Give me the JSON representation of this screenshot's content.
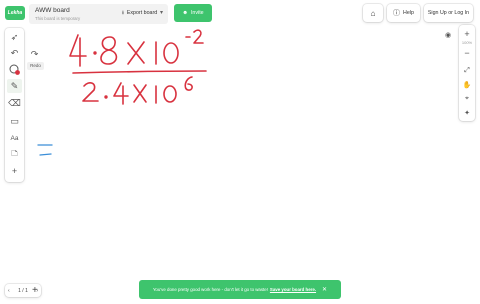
{
  "header": {
    "logo_text": "Lekha",
    "board_title": "AWW board",
    "board_subtitle": "This board is temporary",
    "export_label": "Export board",
    "invite_label": "Invite",
    "help_label": "Help",
    "signin_label": "Sign Up or Log In"
  },
  "toolbar": {
    "text_tool_label": "Aa",
    "redo_label": "Redo"
  },
  "zoom": {
    "level": "100%"
  },
  "pager": {
    "current": "1",
    "total": "/ 1"
  },
  "toast": {
    "message": "You've done pretty good work here - don't let it go to waste!",
    "link": "Save your board here."
  },
  "colors": {
    "accent": "#3ec46d",
    "ink_red": "#d8323f",
    "ink_blue": "#3a8ed8"
  }
}
